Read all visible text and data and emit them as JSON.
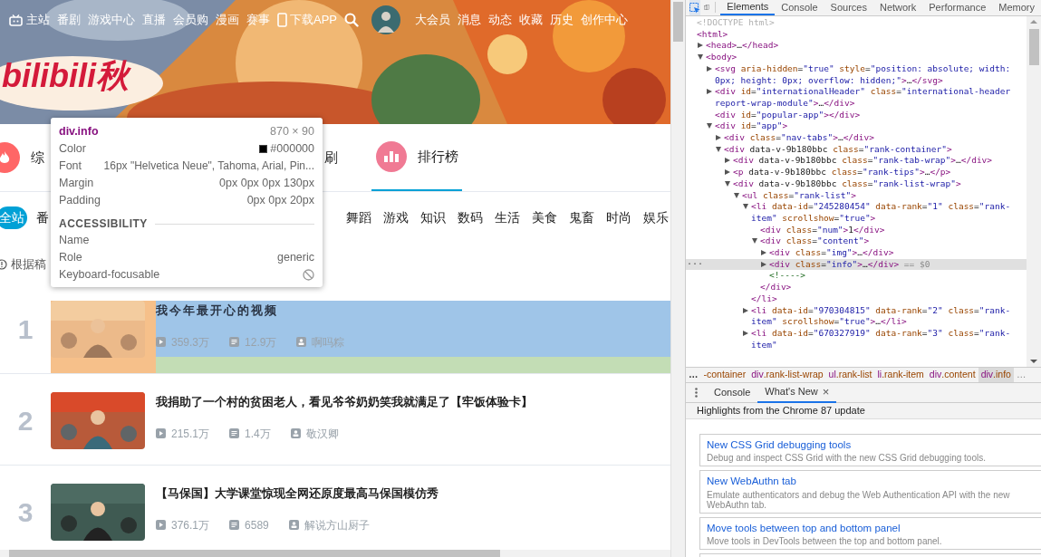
{
  "site": {
    "home_link": "主站",
    "links": [
      "番剧",
      "游戏中心",
      "直播",
      "会员购",
      "漫画",
      "赛事"
    ],
    "app_link": "下载APP",
    "right_links": [
      "大会员",
      "消息",
      "动态",
      "收藏",
      "历史",
      "创作中心"
    ],
    "logo": "bilibili秋",
    "nav_tabs": [
      {
        "label": "综",
        "selected": false
      },
      {
        "label": "刷",
        "selected": false
      },
      {
        "label": "排行榜",
        "selected": true
      }
    ],
    "categories": [
      {
        "label": "全站",
        "selected": true
      },
      {
        "label": "番",
        "selected": false
      },
      {
        "label": "舞蹈",
        "selected": false
      },
      {
        "label": "游戏",
        "selected": false
      },
      {
        "label": "知识",
        "selected": false
      },
      {
        "label": "数码",
        "selected": false
      },
      {
        "label": "生活",
        "selected": false
      },
      {
        "label": "美食",
        "selected": false
      },
      {
        "label": "鬼畜",
        "selected": false
      },
      {
        "label": "时尚",
        "selected": false
      },
      {
        "label": "娱乐",
        "selected": false
      }
    ],
    "tip": "根据稿",
    "rank_list": [
      {
        "rank": "1",
        "title": "我今年最开心的视频",
        "plays": "359.3万",
        "danmaku": "12.9万",
        "author": "啊吗粽",
        "highlighted": true
      },
      {
        "rank": "2",
        "title": "我捐助了一个村的贫困老人，看见爷爷奶奶笑我就满足了【牢饭体验卡】",
        "plays": "215.1万",
        "danmaku": "1.4万",
        "author": "敬汉卿",
        "highlighted": false
      },
      {
        "rank": "3",
        "title": "【马保国】大学课堂惊现全网还原度最高马保国模仿秀",
        "plays": "376.1万",
        "danmaku": "6589",
        "author": "解说方山厨子",
        "highlighted": false
      }
    ]
  },
  "inspect_tooltip": {
    "selector": "div.info",
    "size": "870 × 90",
    "rows": [
      {
        "label": "Color",
        "value": "#000000",
        "kind": "color"
      },
      {
        "label": "Font",
        "value": "16px \"Helvetica Neue\", Tahoma, Arial, Pin...",
        "kind": "text"
      },
      {
        "label": "Margin",
        "value": "0px 0px 0px 130px",
        "kind": "text"
      },
      {
        "label": "Padding",
        "value": "0px 0px 20px",
        "kind": "text"
      }
    ],
    "section": "ACCESSIBILITY",
    "accessibility": [
      {
        "label": "Name"
      },
      {
        "label": "Role",
        "value": "generic"
      },
      {
        "label": "Keyboard-focusable",
        "focusable": false
      }
    ]
  },
  "devtools": {
    "tabs": [
      {
        "label": "Elements",
        "selected": true
      },
      {
        "label": "Console",
        "selected": false
      },
      {
        "label": "Sources",
        "selected": false
      },
      {
        "label": "Network",
        "selected": false
      },
      {
        "label": "Performance",
        "selected": false
      },
      {
        "label": "Memory",
        "selected": false
      }
    ],
    "dom_tree": [
      {
        "text": "<!DOCTYPE html>",
        "kind": "doctype"
      },
      {
        "text": "<html>",
        "kind": "tag",
        "children": [
          {
            "text": "<head>…</head>",
            "kind": "tag",
            "expanded": false
          },
          {
            "text": "<body>",
            "kind": "tag",
            "expanded": true,
            "children": [
              {
                "text": "<svg aria-hidden=\"true\" style=\"position: absolute; width: 0px; height: 0px; overflow: hidden;\">…</svg>",
                "kind": "tag",
                "expanded": false
              },
              {
                "text": "<div id=\"internationalHeader\" class=\"international-header report-wrap-module\">…</div>",
                "kind": "tag",
                "expanded": false
              },
              {
                "text": "<div id=\"popular-app\"></div>",
                "kind": "tag"
              },
              {
                "text": "<div id=\"app\">",
                "kind": "tag",
                "expanded": true,
                "children": [
                  {
                    "text": "<div class=\"nav-tabs\">…</div>",
                    "kind": "tag",
                    "expanded": false
                  },
                  {
                    "text": "<div data-v-9b180bbc class=\"rank-container\">",
                    "kind": "tag",
                    "expanded": true,
                    "children": [
                      {
                        "text": "<div data-v-9b180bbc class=\"rank-tab-wrap\">…</div>",
                        "kind": "tag",
                        "expanded": false
                      },
                      {
                        "text": "<p data-v-9b180bbc class=\"rank-tips\">…</p>",
                        "kind": "tag",
                        "expanded": false
                      },
                      {
                        "text": "<div data-v-9b180bbc class=\"rank-list-wrap\">",
                        "kind": "tag",
                        "expanded": true,
                        "children": [
                          {
                            "text": "<ul class=\"rank-list\">",
                            "kind": "tag",
                            "expanded": true,
                            "children": [
                              {
                                "text": "<li data-id=\"245280454\" data-rank=\"1\" class=\"rank-item\" scrollshow=\"true\">",
                                "kind": "tag",
                                "expanded": true,
                                "close": "</li>",
                                "children": [
                                  {
                                    "text": "<div class=\"num\">1</div>",
                                    "kind": "tag"
                                  },
                                  {
                                    "text": "<div class=\"content\">",
                                    "kind": "tag",
                                    "expanded": true,
                                    "close": "</div>",
                                    "children": [
                                      {
                                        "text": "<div class=\"img\">…</div>",
                                        "kind": "tag",
                                        "expanded": false
                                      },
                                      {
                                        "text": "<div class=\"info\">…</div>",
                                        "kind": "tag",
                                        "expanded": false,
                                        "selected": true,
                                        "marker": "== $0",
                                        "gutter": "···"
                                      },
                                      {
                                        "text": "<!---->",
                                        "kind": "comment"
                                      }
                                    ]
                                  }
                                ]
                              },
                              {
                                "text": "<li data-id=\"970304815\" data-rank=\"2\" class=\"rank-item\" scrollshow=\"true\">…</li>",
                                "kind": "tag",
                                "expanded": false
                              },
                              {
                                "text": "<li data-id=\"670327919\" data-rank=\"3\" class=\"rank-item\"",
                                "kind": "tag",
                                "expanded": false
                              }
                            ]
                          }
                        ]
                      }
                    ]
                  }
                ]
              }
            ]
          }
        ]
      }
    ],
    "breadcrumbs": {
      "overflow_left": "…",
      "overflow_right": "…",
      "items": [
        {
          "label": "-container",
          "selected": false
        },
        {
          "label": "div.rank-list-wrap",
          "selected": false
        },
        {
          "label": "ul.rank-list",
          "selected": false
        },
        {
          "label": "li.rank-item",
          "selected": false
        },
        {
          "label": "div.content",
          "selected": false
        },
        {
          "label": "div.info",
          "selected": true
        }
      ]
    },
    "drawer": {
      "tabs": [
        {
          "label": "Console",
          "selected": false,
          "closable": false
        },
        {
          "label": "What's New",
          "selected": true,
          "closable": true
        }
      ],
      "close_glyph": "×",
      "banner": "Highlights from the Chrome 87 update",
      "cards": [
        {
          "title": "New CSS Grid debugging tools",
          "description": "Debug and inspect CSS Grid with the new CSS Grid debugging tools."
        },
        {
          "title": "New WebAuthn tab",
          "description": "Emulate authenticators and debug the Web Authentication API with the new WebAuthn tab."
        },
        {
          "title": "Move tools between top and bottom panel",
          "description": "Move tools in DevTools between the top and bottom panel."
        }
      ]
    }
  }
}
